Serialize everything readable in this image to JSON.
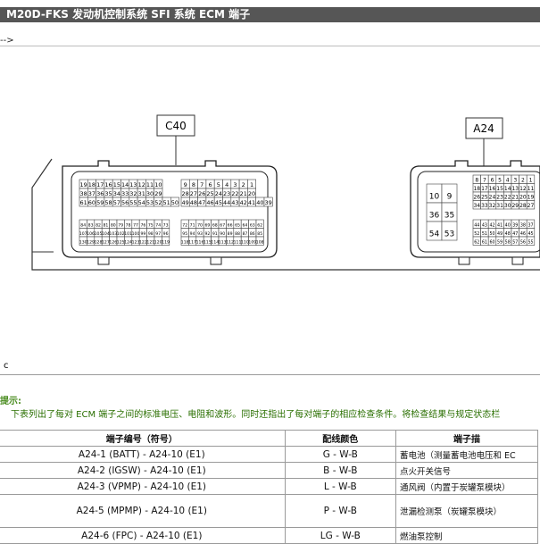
{
  "header": {
    "title": "M20D-FKS 发动机控制系统  SFI 系统  ECM 端子",
    "back_arrow": "-->"
  },
  "diagram": {
    "connector_c40_label": "C40",
    "connector_a24_label": "A24",
    "c40_left_rows": [
      [
        "19",
        "18",
        "17",
        "16",
        "15",
        "14",
        "13",
        "12",
        "11",
        "10"
      ],
      [
        "38",
        "37",
        "36",
        "35",
        "34",
        "33",
        "32",
        "31",
        "30",
        "29"
      ],
      [
        "61",
        "60",
        "59",
        "58",
        "57",
        "56",
        "55",
        "54",
        "53",
        "52",
        "51",
        "50"
      ]
    ],
    "c40_left_small_rows": [
      [
        "84",
        "83",
        "82",
        "81",
        "80",
        "79",
        "78",
        "77",
        "76",
        "75",
        "74",
        "73"
      ],
      [
        "107",
        "106",
        "105",
        "104",
        "103",
        "102",
        "101",
        "100",
        "99",
        "98",
        "97",
        "96"
      ],
      [
        "130",
        "129",
        "128",
        "127",
        "126",
        "125",
        "124",
        "123",
        "122",
        "121",
        "120",
        "119"
      ]
    ],
    "c40_right_rows": [
      [
        "9",
        "8",
        "7",
        "6",
        "5",
        "4",
        "3",
        "2",
        "1"
      ],
      [
        "28",
        "27",
        "26",
        "25",
        "24",
        "23",
        "22",
        "21",
        "20"
      ],
      [
        "49",
        "48",
        "47",
        "46",
        "45",
        "44",
        "43",
        "42",
        "41",
        "40",
        "39"
      ]
    ],
    "c40_right_small_rows": [
      [
        "72",
        "71",
        "70",
        "69",
        "68",
        "67",
        "66",
        "65",
        "64",
        "63",
        "62"
      ],
      [
        "95",
        "94",
        "93",
        "92",
        "91",
        "90",
        "89",
        "88",
        "87",
        "86",
        "85"
      ],
      [
        "118",
        "117",
        "116",
        "115",
        "114",
        "113",
        "112",
        "111",
        "110",
        "109",
        "108"
      ]
    ],
    "a24_big_pins": [
      [
        "10",
        "9"
      ],
      [
        "36",
        "35"
      ],
      [
        "54",
        "53"
      ]
    ],
    "a24_right_rows": [
      [
        "8",
        "7",
        "6",
        "5",
        "4",
        "3",
        "2",
        "1"
      ],
      [
        "18",
        "17",
        "16",
        "15",
        "14",
        "13",
        "12",
        "11"
      ],
      [
        "26",
        "25",
        "24",
        "23",
        "22",
        "21",
        "20",
        "19"
      ],
      [
        "34",
        "33",
        "32",
        "31",
        "30",
        "29",
        "28",
        "27"
      ]
    ],
    "a24_right_small_rows": [
      [
        "44",
        "43",
        "42",
        "41",
        "40",
        "39",
        "38",
        "37"
      ],
      [
        "52",
        "51",
        "50",
        "49",
        "48",
        "47",
        "46",
        "45"
      ],
      [
        "62",
        "61",
        "60",
        "59",
        "58",
        "57",
        "56",
        "55"
      ]
    ]
  },
  "section_label": "c",
  "hint": {
    "title": "提示:",
    "text": "下表列出了每对 ECM 端子之间的标准电压、电阻和波形。同时还指出了每对端子的相应检查条件。将检查结果与规定状态栏"
  },
  "table": {
    "headers": [
      "端子编号（符号）",
      "配线颜色",
      "端子描"
    ],
    "rows": [
      {
        "terminal": "A24-1 (BATT) - A24-10 (E1)",
        "color": "G - W-B",
        "desc": "蓄电池（测量蓄电池电压和 EC"
      },
      {
        "terminal": "A24-2 (IGSW) - A24-10 (E1)",
        "color": "B - W-B",
        "desc": "点火开关信号"
      },
      {
        "terminal": "A24-3 (VPMP) - A24-10 (E1)",
        "color": "L - W-B",
        "desc": "通风阀（内置于炭罐泵模块）"
      },
      {
        "terminal": "A24-5 (MPMP) - A24-10 (E1)",
        "color": "P - W-B",
        "desc": "泄漏检测泵（炭罐泵模块）"
      },
      {
        "terminal": "A24-6 (FPC) - A24-10 (E1)",
        "color": "LG - W-B",
        "desc": "燃油泵控制"
      }
    ]
  }
}
